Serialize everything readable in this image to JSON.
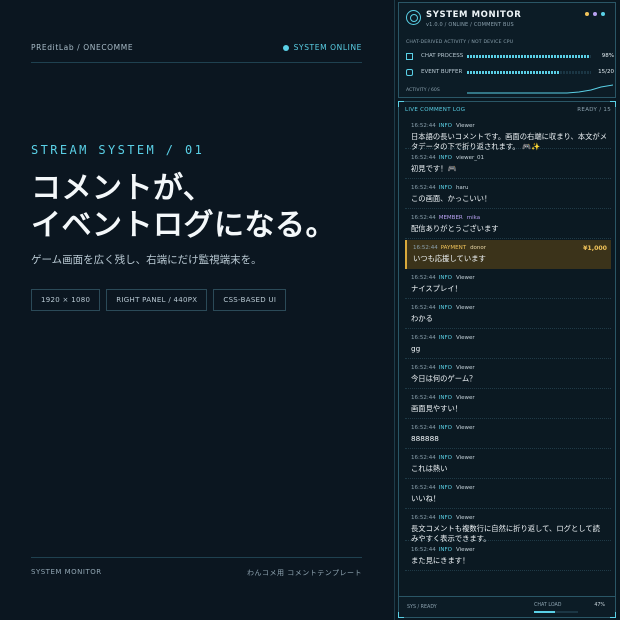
{
  "left": {
    "brand": "PREditLab / ONECOMME",
    "status": "SYSTEM ONLINE",
    "kicker": "STREAM SYSTEM / 01",
    "headline_1": "コメントが、",
    "headline_2": "イベントログになる。",
    "lead": "ゲーム画面を広く残し、右端にだけ監視端末を。",
    "chips": [
      "1920 × 1080",
      "RIGHT PANEL / 440PX",
      "CSS-BASED UI"
    ],
    "footer_left": "SYSTEM MONITOR",
    "footer_right": "わんコメ用 コメントテンプレート"
  },
  "monitor": {
    "title": "SYSTEM MONITOR",
    "subtitle": "v1.0.0 / ONLINE / COMMENT BUS",
    "caption": "CHAT-DERIVED ACTIVITY / NOT DEVICE CPU",
    "rows": [
      {
        "label": "CHAT PROCESS",
        "value": "98%",
        "fill": 0.98
      },
      {
        "label": "EVENT BUFFER",
        "value": "15/20",
        "fill": 0.75
      }
    ],
    "activity_label": "ACTIVITY / 60S",
    "dot_colors": [
      "#f0c35a",
      "#b7a0f0",
      "#5ad0e6"
    ]
  },
  "log": {
    "title": "LIVE COMMENT LOG",
    "ready": "READY / 15",
    "items": [
      {
        "time": "16:52:44",
        "level": "INFO",
        "user": "Viewer",
        "msg": "日本語の長いコメントです。画面の右端に収まり、本文がメタデータの下で折り返されます。 🎮✨",
        "kind": "info",
        "lines": 2
      },
      {
        "time": "16:52:44",
        "level": "INFO",
        "user": "viewer_01",
        "msg": "初見です！🎮",
        "kind": "info",
        "lines": 1
      },
      {
        "time": "16:52:44",
        "level": "INFO",
        "user": "haru",
        "msg": "この画面、かっこいい！",
        "kind": "info",
        "lines": 1
      },
      {
        "time": "16:52:44",
        "level": "MEMBER",
        "user": "mika",
        "msg": "配信ありがとうございます",
        "kind": "member",
        "lines": 1
      },
      {
        "time": "16:52:44",
        "level": "PAYMENT",
        "user": "donor",
        "msg": "いつも応援しています",
        "kind": "payment",
        "amount": "¥1,000",
        "lines": 1
      },
      {
        "time": "16:52:44",
        "level": "INFO",
        "user": "Viewer",
        "msg": "ナイスプレイ！",
        "kind": "info",
        "lines": 1
      },
      {
        "time": "16:52:44",
        "level": "INFO",
        "user": "Viewer",
        "msg": "わかる",
        "kind": "info",
        "lines": 1
      },
      {
        "time": "16:52:44",
        "level": "INFO",
        "user": "Viewer",
        "msg": "gg",
        "kind": "info",
        "lines": 1
      },
      {
        "time": "16:52:44",
        "level": "INFO",
        "user": "Viewer",
        "msg": "今日は何のゲーム？",
        "kind": "info",
        "lines": 1
      },
      {
        "time": "16:52:44",
        "level": "INFO",
        "user": "Viewer",
        "msg": "画面見やすい！",
        "kind": "info",
        "lines": 1
      },
      {
        "time": "16:52:44",
        "level": "INFO",
        "user": "Viewer",
        "msg": "888888",
        "kind": "info",
        "lines": 1
      },
      {
        "time": "16:52:44",
        "level": "INFO",
        "user": "Viewer",
        "msg": "これは熱い",
        "kind": "info",
        "lines": 1
      },
      {
        "time": "16:52:44",
        "level": "INFO",
        "user": "Viewer",
        "msg": "いいね！",
        "kind": "info",
        "lines": 1
      },
      {
        "time": "16:52:44",
        "level": "INFO",
        "user": "Viewer",
        "msg": "長文コメントも複数行に自然に折り返して、ログとして読みやすく表示できます。",
        "kind": "info",
        "lines": 2
      },
      {
        "time": "16:52:44",
        "level": "INFO",
        "user": "Viewer",
        "msg": "また見にきます！",
        "kind": "info",
        "lines": 1
      }
    ]
  },
  "status_bar": {
    "left": "SYS / READY",
    "load_label": "CHAT LOAD",
    "load_value": "47%",
    "load_fill": 0.47
  }
}
